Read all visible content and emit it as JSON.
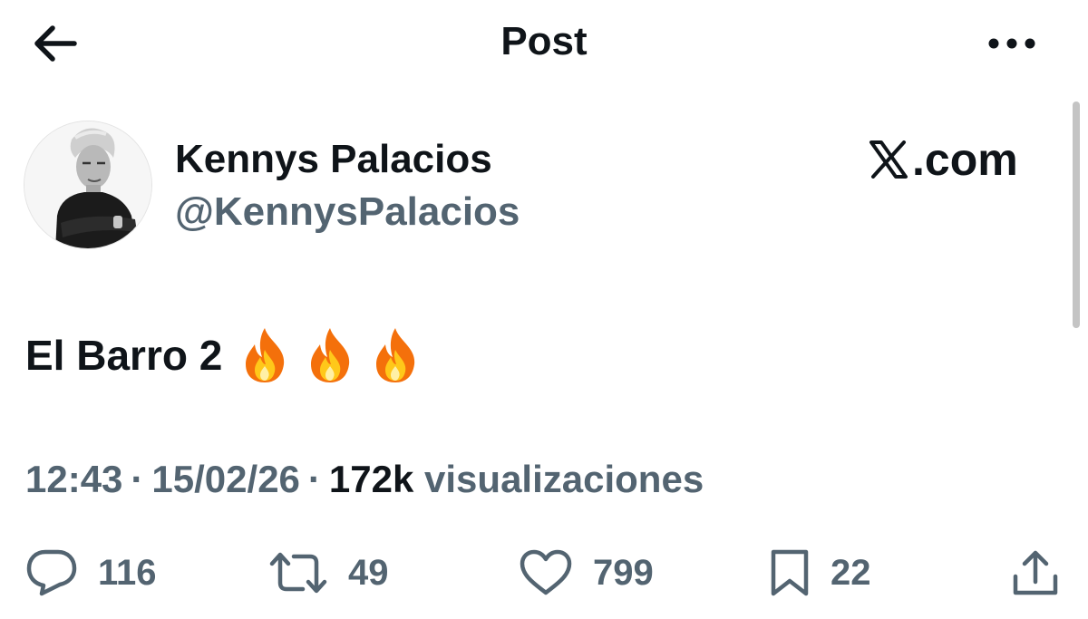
{
  "header": {
    "title": "Post",
    "back_icon": "arrow-left-icon",
    "more_icon": "ellipsis-icon"
  },
  "author": {
    "name": "Kennys Palacios",
    "handle": "@KennysPalacios",
    "avatar_icon": "profile-photo"
  },
  "watermark": {
    "logo_icon": "x-logo-icon",
    "text": ".com"
  },
  "post": {
    "text": "El Barro 2",
    "emojis": [
      "🔥",
      "🔥",
      "🔥"
    ]
  },
  "meta": {
    "time": "12:43",
    "separator": "·",
    "date": "15/02/26",
    "views_count": "172k",
    "views_label": "visualizaciones"
  },
  "actions": {
    "replies": "116",
    "reposts": "49",
    "likes": "799",
    "bookmarks": "22"
  },
  "colors": {
    "text_primary": "#0f1419",
    "text_secondary": "#536471",
    "background": "#ffffff"
  }
}
